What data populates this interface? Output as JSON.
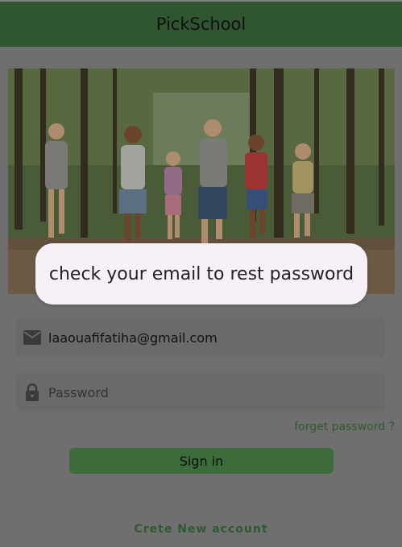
{
  "app": {
    "title": "PickSchool"
  },
  "hero": {
    "image": "children-running-in-forest-photo"
  },
  "toast": {
    "message": "check your email to rest password"
  },
  "form": {
    "email_icon": "mail-icon",
    "email_value": "laaouafifatiha@gmail.com",
    "password_icon": "lock-icon",
    "password_placeholder": "Password",
    "forget_label": "forget password ?",
    "signin_label": "Sign in",
    "create_label": "Crete New account"
  },
  "colors": {
    "appbar": "#2f5630",
    "scrim": "#6f6f6f",
    "primary_button": "#3c6b3c",
    "link": "#2f5a2f",
    "toast_bg": "#f6f1f8"
  }
}
